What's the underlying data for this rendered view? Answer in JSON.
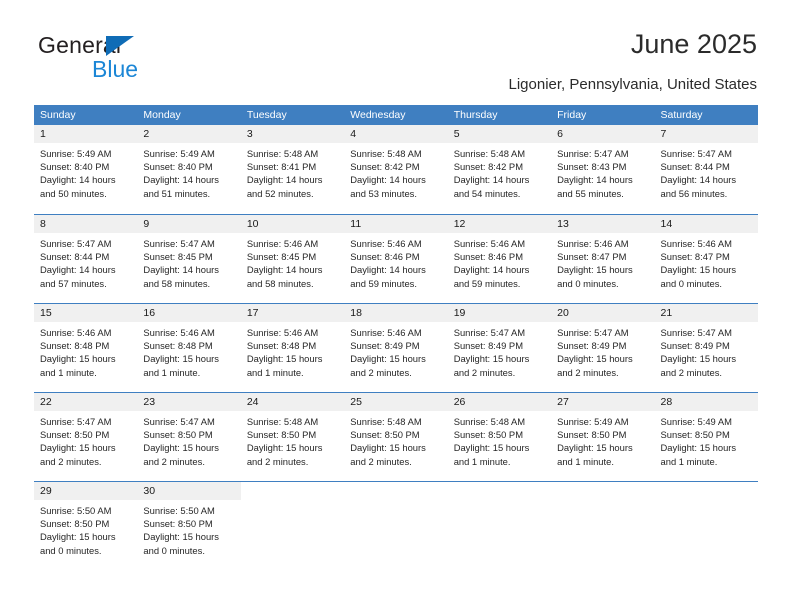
{
  "brand": {
    "name_line1": "General",
    "name_line2": "Blue",
    "accent_color": "#1b86d6",
    "logo_triangle_color": "#0f6cb6"
  },
  "header": {
    "title": "June 2025",
    "subtitle": "Ligonier, Pennsylvania, United States"
  },
  "calendar": {
    "header_bg": "#3f7fc1",
    "header_text_color": "#ffffff",
    "daynum_band_bg": "#f0f0f0",
    "weekday_headers": [
      "Sunday",
      "Monday",
      "Tuesday",
      "Wednesday",
      "Thursday",
      "Friday",
      "Saturday"
    ],
    "weeks": [
      [
        {
          "day": "1",
          "sunrise": "Sunrise: 5:49 AM",
          "sunset": "Sunset: 8:40 PM",
          "daylight_line1": "Daylight: 14 hours",
          "daylight_line2": "and 50 minutes."
        },
        {
          "day": "2",
          "sunrise": "Sunrise: 5:49 AM",
          "sunset": "Sunset: 8:40 PM",
          "daylight_line1": "Daylight: 14 hours",
          "daylight_line2": "and 51 minutes."
        },
        {
          "day": "3",
          "sunrise": "Sunrise: 5:48 AM",
          "sunset": "Sunset: 8:41 PM",
          "daylight_line1": "Daylight: 14 hours",
          "daylight_line2": "and 52 minutes."
        },
        {
          "day": "4",
          "sunrise": "Sunrise: 5:48 AM",
          "sunset": "Sunset: 8:42 PM",
          "daylight_line1": "Daylight: 14 hours",
          "daylight_line2": "and 53 minutes."
        },
        {
          "day": "5",
          "sunrise": "Sunrise: 5:48 AM",
          "sunset": "Sunset: 8:42 PM",
          "daylight_line1": "Daylight: 14 hours",
          "daylight_line2": "and 54 minutes."
        },
        {
          "day": "6",
          "sunrise": "Sunrise: 5:47 AM",
          "sunset": "Sunset: 8:43 PM",
          "daylight_line1": "Daylight: 14 hours",
          "daylight_line2": "and 55 minutes."
        },
        {
          "day": "7",
          "sunrise": "Sunrise: 5:47 AM",
          "sunset": "Sunset: 8:44 PM",
          "daylight_line1": "Daylight: 14 hours",
          "daylight_line2": "and 56 minutes."
        }
      ],
      [
        {
          "day": "8",
          "sunrise": "Sunrise: 5:47 AM",
          "sunset": "Sunset: 8:44 PM",
          "daylight_line1": "Daylight: 14 hours",
          "daylight_line2": "and 57 minutes."
        },
        {
          "day": "9",
          "sunrise": "Sunrise: 5:47 AM",
          "sunset": "Sunset: 8:45 PM",
          "daylight_line1": "Daylight: 14 hours",
          "daylight_line2": "and 58 minutes."
        },
        {
          "day": "10",
          "sunrise": "Sunrise: 5:46 AM",
          "sunset": "Sunset: 8:45 PM",
          "daylight_line1": "Daylight: 14 hours",
          "daylight_line2": "and 58 minutes."
        },
        {
          "day": "11",
          "sunrise": "Sunrise: 5:46 AM",
          "sunset": "Sunset: 8:46 PM",
          "daylight_line1": "Daylight: 14 hours",
          "daylight_line2": "and 59 minutes."
        },
        {
          "day": "12",
          "sunrise": "Sunrise: 5:46 AM",
          "sunset": "Sunset: 8:46 PM",
          "daylight_line1": "Daylight: 14 hours",
          "daylight_line2": "and 59 minutes."
        },
        {
          "day": "13",
          "sunrise": "Sunrise: 5:46 AM",
          "sunset": "Sunset: 8:47 PM",
          "daylight_line1": "Daylight: 15 hours",
          "daylight_line2": "and 0 minutes."
        },
        {
          "day": "14",
          "sunrise": "Sunrise: 5:46 AM",
          "sunset": "Sunset: 8:47 PM",
          "daylight_line1": "Daylight: 15 hours",
          "daylight_line2": "and 0 minutes."
        }
      ],
      [
        {
          "day": "15",
          "sunrise": "Sunrise: 5:46 AM",
          "sunset": "Sunset: 8:48 PM",
          "daylight_line1": "Daylight: 15 hours",
          "daylight_line2": "and 1 minute."
        },
        {
          "day": "16",
          "sunrise": "Sunrise: 5:46 AM",
          "sunset": "Sunset: 8:48 PM",
          "daylight_line1": "Daylight: 15 hours",
          "daylight_line2": "and 1 minute."
        },
        {
          "day": "17",
          "sunrise": "Sunrise: 5:46 AM",
          "sunset": "Sunset: 8:48 PM",
          "daylight_line1": "Daylight: 15 hours",
          "daylight_line2": "and 1 minute."
        },
        {
          "day": "18",
          "sunrise": "Sunrise: 5:46 AM",
          "sunset": "Sunset: 8:49 PM",
          "daylight_line1": "Daylight: 15 hours",
          "daylight_line2": "and 2 minutes."
        },
        {
          "day": "19",
          "sunrise": "Sunrise: 5:47 AM",
          "sunset": "Sunset: 8:49 PM",
          "daylight_line1": "Daylight: 15 hours",
          "daylight_line2": "and 2 minutes."
        },
        {
          "day": "20",
          "sunrise": "Sunrise: 5:47 AM",
          "sunset": "Sunset: 8:49 PM",
          "daylight_line1": "Daylight: 15 hours",
          "daylight_line2": "and 2 minutes."
        },
        {
          "day": "21",
          "sunrise": "Sunrise: 5:47 AM",
          "sunset": "Sunset: 8:49 PM",
          "daylight_line1": "Daylight: 15 hours",
          "daylight_line2": "and 2 minutes."
        }
      ],
      [
        {
          "day": "22",
          "sunrise": "Sunrise: 5:47 AM",
          "sunset": "Sunset: 8:50 PM",
          "daylight_line1": "Daylight: 15 hours",
          "daylight_line2": "and 2 minutes."
        },
        {
          "day": "23",
          "sunrise": "Sunrise: 5:47 AM",
          "sunset": "Sunset: 8:50 PM",
          "daylight_line1": "Daylight: 15 hours",
          "daylight_line2": "and 2 minutes."
        },
        {
          "day": "24",
          "sunrise": "Sunrise: 5:48 AM",
          "sunset": "Sunset: 8:50 PM",
          "daylight_line1": "Daylight: 15 hours",
          "daylight_line2": "and 2 minutes."
        },
        {
          "day": "25",
          "sunrise": "Sunrise: 5:48 AM",
          "sunset": "Sunset: 8:50 PM",
          "daylight_line1": "Daylight: 15 hours",
          "daylight_line2": "and 2 minutes."
        },
        {
          "day": "26",
          "sunrise": "Sunrise: 5:48 AM",
          "sunset": "Sunset: 8:50 PM",
          "daylight_line1": "Daylight: 15 hours",
          "daylight_line2": "and 1 minute."
        },
        {
          "day": "27",
          "sunrise": "Sunrise: 5:49 AM",
          "sunset": "Sunset: 8:50 PM",
          "daylight_line1": "Daylight: 15 hours",
          "daylight_line2": "and 1 minute."
        },
        {
          "day": "28",
          "sunrise": "Sunrise: 5:49 AM",
          "sunset": "Sunset: 8:50 PM",
          "daylight_line1": "Daylight: 15 hours",
          "daylight_line2": "and 1 minute."
        }
      ],
      [
        {
          "day": "29",
          "sunrise": "Sunrise: 5:50 AM",
          "sunset": "Sunset: 8:50 PM",
          "daylight_line1": "Daylight: 15 hours",
          "daylight_line2": "and 0 minutes."
        },
        {
          "day": "30",
          "sunrise": "Sunrise: 5:50 AM",
          "sunset": "Sunset: 8:50 PM",
          "daylight_line1": "Daylight: 15 hours",
          "daylight_line2": "and 0 minutes."
        },
        {
          "day": "",
          "sunrise": "",
          "sunset": "",
          "daylight_line1": "",
          "daylight_line2": ""
        },
        {
          "day": "",
          "sunrise": "",
          "sunset": "",
          "daylight_line1": "",
          "daylight_line2": ""
        },
        {
          "day": "",
          "sunrise": "",
          "sunset": "",
          "daylight_line1": "",
          "daylight_line2": ""
        },
        {
          "day": "",
          "sunrise": "",
          "sunset": "",
          "daylight_line1": "",
          "daylight_line2": ""
        },
        {
          "day": "",
          "sunrise": "",
          "sunset": "",
          "daylight_line1": "",
          "daylight_line2": ""
        }
      ]
    ]
  }
}
